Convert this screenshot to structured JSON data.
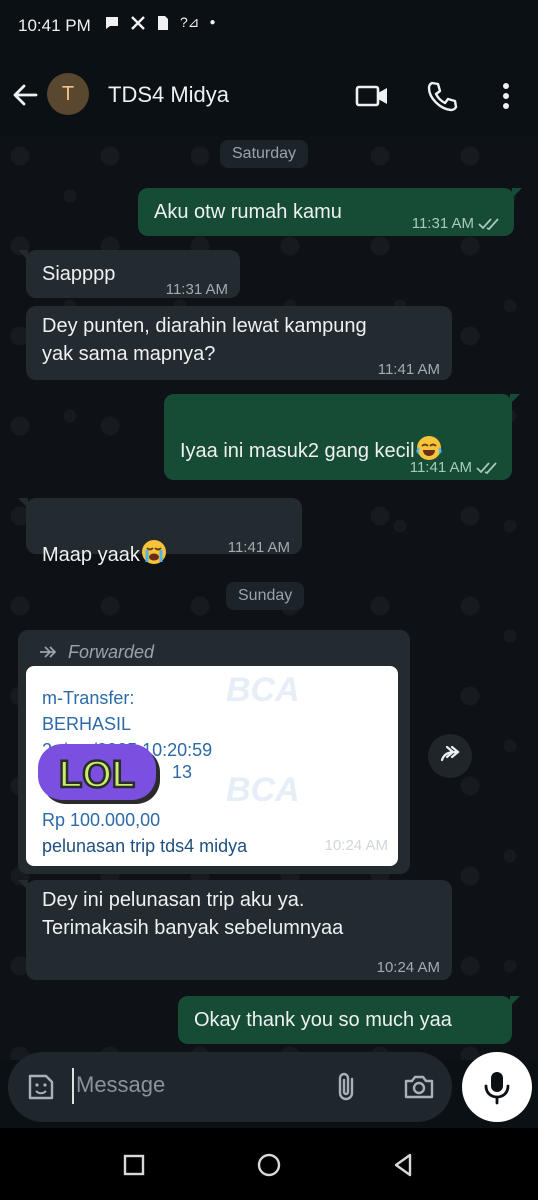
{
  "status_bar": {
    "time": "10:41 PM",
    "signal_text": "?⊿"
  },
  "header": {
    "avatar_initial": "T",
    "contact_name": "TDS4 Midya"
  },
  "day_separators": [
    "Saturday",
    "Sunday"
  ],
  "messages": [
    {
      "dir": "out",
      "text": "Aku otw rumah kamu",
      "time": "11:31 AM",
      "read": true
    },
    {
      "dir": "in",
      "text": "Siapppp",
      "time": "11:31 AM"
    },
    {
      "dir": "in",
      "text": "Dey punten, diarahin lewat kampung\nyak sama mapnya?",
      "time": "11:41 AM"
    },
    {
      "dir": "out",
      "text": "Iyaa ini masuk2 gang kecil",
      "emoji": "rolling-laughing",
      "time": "11:41 AM",
      "read": true
    },
    {
      "dir": "in",
      "text": "Maap yaak",
      "emoji": "crying-face",
      "time": "11:41 AM"
    },
    {
      "dir": "in",
      "text": "Dey ini pelunasan trip aku ya.\nTerimakasih banyak sebelumnyaa",
      "time": "10:24 AM"
    },
    {
      "dir": "out",
      "text": "Okay thank you so much yaa"
    }
  ],
  "forwarded": {
    "label": "Forwarded",
    "time": "10:24 AM",
    "receipt_lines": [
      "m-Transfer:",
      "BERHASIL",
      "2_/_ _/2025 10:20:59",
      "13",
      "Rp 100.000,00",
      "pelunasan trip tds4 midya"
    ],
    "watermark": "BCA",
    "sticker_text": "LOL"
  },
  "composer": {
    "placeholder": "Message"
  },
  "colors": {
    "incoming": "#242b30",
    "outgoing": "#164b36",
    "background": "#0b1014"
  }
}
